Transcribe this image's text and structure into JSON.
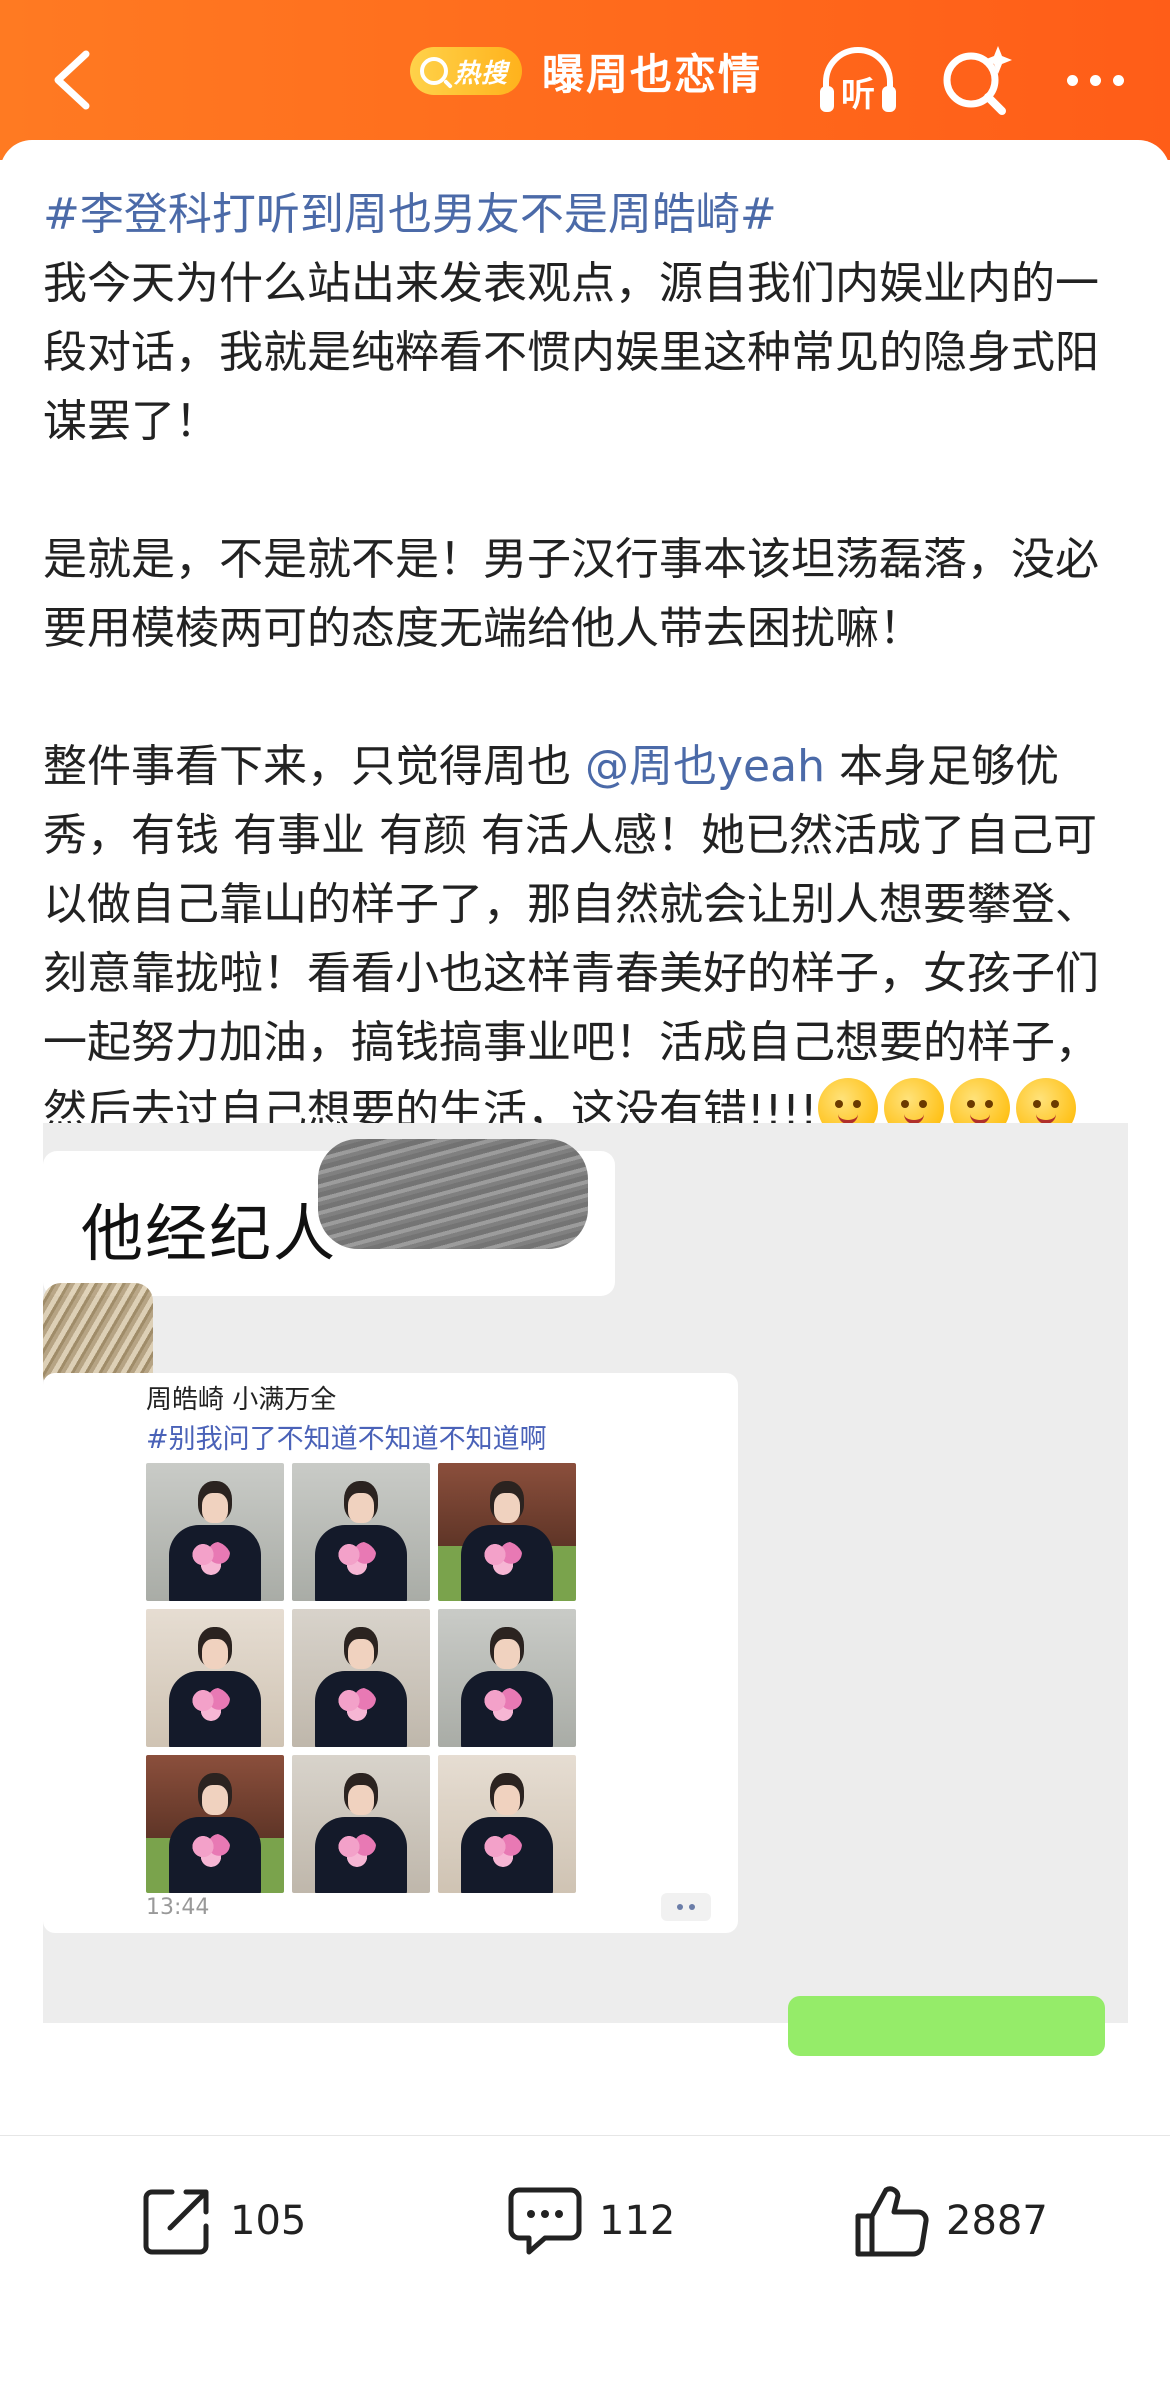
{
  "header": {
    "hot_search_label": "热搜",
    "topic_title": "曝周也恋情",
    "listen_label": "听",
    "background_color": "#ff6a1c"
  },
  "post": {
    "hashtag": "#李登科打听到周也男友不是周皓崎#",
    "paragraph1": "我今天为什么站出来发表观点，源自我们内娱业内的一段对话，我就是纯粹看不惯内娱里这种常见的隐身式阳谋罢了！",
    "paragraph2": "是就是，不是就不是！男子汉行事本该坦荡磊落，没必要用模棱两可的态度无端给他人带去困扰嘛！",
    "paragraph3_before": "整件事看下来，只觉得周也 ",
    "mention": "@周也yeah",
    "paragraph3_after": " 本身足够优秀，有钱 有事业 有颜 有活人感！她已然活成了自己可以做自己靠山的样子了，那自然就会让别人想要攀登、刻意靠拢啦！看看小也这样青春美好的样子，女孩子们一起努力加油，搞钱搞事业吧！活成自己想要的样子，然后去过自己想要的生活，这没有错!!!!",
    "emojis": [
      "crying-laugh-emoji",
      "angel-emoji",
      "tears-emoji",
      "cheering-emoji",
      "flower-emoji"
    ]
  },
  "screenshot": {
    "agent_text": "他经纪人",
    "forwarded_name": "周皓崎 小满万全",
    "forwarded_tag": "#别我问了不知道不知道不知道啊",
    "time": "13:44",
    "photo_count": 9
  },
  "actions": {
    "share_count": "105",
    "comment_count": "112",
    "like_count": "2887"
  }
}
